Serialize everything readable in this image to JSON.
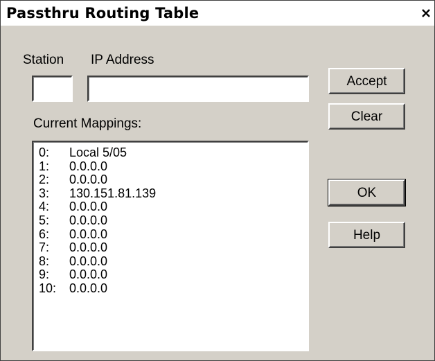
{
  "window": {
    "title": "Passthru Routing Table",
    "close_label": "x"
  },
  "labels": {
    "station": "Station",
    "ip_address": "IP Address",
    "current_mappings": "Current Mappings:"
  },
  "inputs": {
    "station_value": "",
    "ip_value": ""
  },
  "buttons": {
    "accept": "Accept",
    "clear": "Clear",
    "ok": "OK",
    "help": "Help"
  },
  "mappings": [
    {
      "index": "0:",
      "address": "Local 5/05"
    },
    {
      "index": "1:",
      "address": "0.0.0.0"
    },
    {
      "index": "2:",
      "address": "0.0.0.0"
    },
    {
      "index": "3:",
      "address": "130.151.81.139"
    },
    {
      "index": "4:",
      "address": "0.0.0.0"
    },
    {
      "index": "5:",
      "address": "0.0.0.0"
    },
    {
      "index": "6:",
      "address": "0.0.0.0"
    },
    {
      "index": "7:",
      "address": "0.0.0.0"
    },
    {
      "index": "8:",
      "address": "0.0.0.0"
    },
    {
      "index": "9:",
      "address": "0.0.0.0"
    },
    {
      "index": "10:",
      "address": "0.0.0.0"
    }
  ]
}
